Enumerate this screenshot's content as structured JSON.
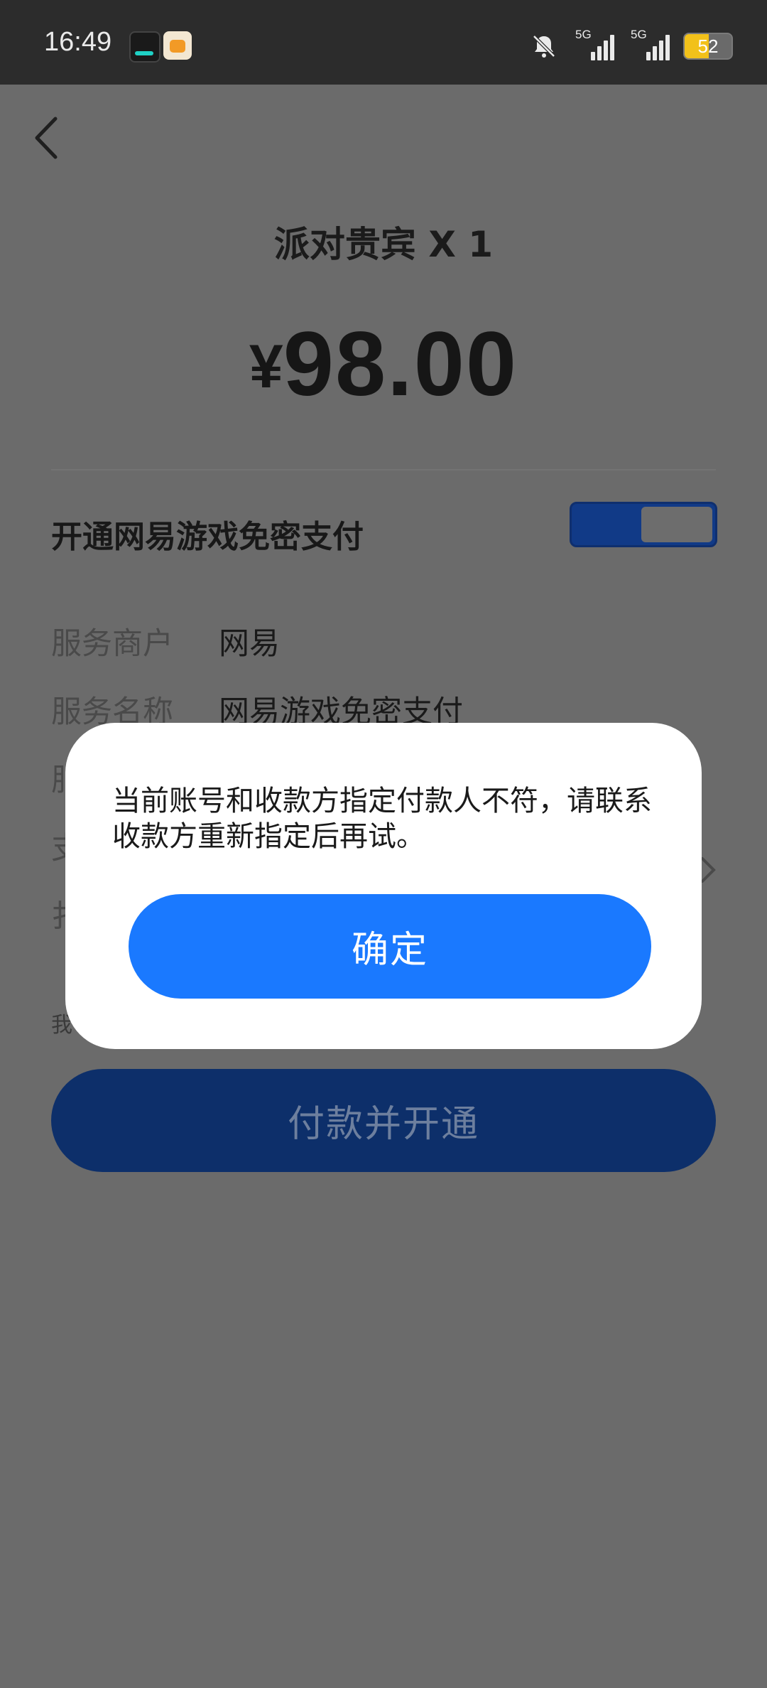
{
  "status_bar": {
    "time": "16:49",
    "app_icons": [
      "app-icon-1",
      "app-icon-2"
    ],
    "signal_1_label": "5G",
    "signal_2_label": "5G",
    "battery": "52",
    "battery_level": 0.52,
    "battery_color": "#f2c11a"
  },
  "header": {
    "back_icon": "chevron-left-icon"
  },
  "product": {
    "title": "派对贵宾 X 1",
    "currency": "¥",
    "amount": "98.00"
  },
  "toggle": {
    "label": "开通网易游戏免密支付",
    "on": true,
    "color": "#113a87"
  },
  "details": [
    {
      "key": "服务商户",
      "value": "网易"
    },
    {
      "key": "服务名称",
      "value": "网易游戏免密支付"
    }
  ],
  "obscured_fragments": [
    "服",
    "支",
    "扌",
    "我"
  ],
  "pay_button": {
    "label": "付款并开通"
  },
  "dialog": {
    "message": "当前账号和收款方指定付款人不符，请联系收款方重新指定后再试。",
    "confirm_label": "确定",
    "accent": "#1a79ff"
  }
}
